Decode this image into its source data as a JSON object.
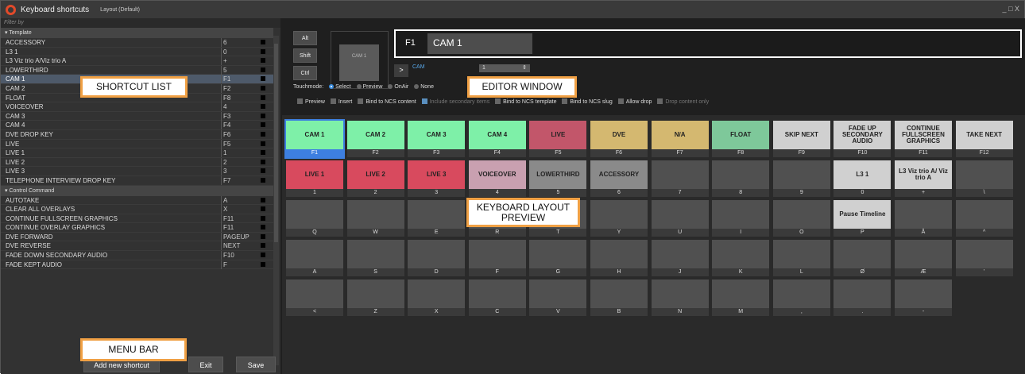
{
  "window": {
    "title": "Keyboard shortcuts",
    "layout": "Layout (Default)",
    "controls": "_ □ X"
  },
  "filter_placeholder": "Filter by",
  "template": {
    "header": "▾ Template",
    "rows": [
      {
        "name": "ACCESSORY",
        "key": "6"
      },
      {
        "name": "L3 1",
        "key": "0"
      },
      {
        "name": "L3 Viz trio A/Viz trio A",
        "key": "+"
      },
      {
        "name": "LOWERTHIRD",
        "key": "5"
      },
      {
        "name": "CAM 1",
        "key": "F1"
      },
      {
        "name": "CAM 2",
        "key": "F2"
      },
      {
        "name": "FLOAT",
        "key": "F8"
      },
      {
        "name": "VOICEOVER",
        "key": "4"
      },
      {
        "name": "CAM 3",
        "key": "F3"
      },
      {
        "name": "CAM 4",
        "key": "F4"
      },
      {
        "name": "DVE DROP KEY",
        "key": "F6"
      },
      {
        "name": "LIVE",
        "key": "F5"
      },
      {
        "name": "LIVE 1",
        "key": "1"
      },
      {
        "name": "LIVE 2",
        "key": "2"
      },
      {
        "name": "LIVE 3",
        "key": "3"
      },
      {
        "name": "TELEPHONE INTERVIEW DROP KEY",
        "key": "F7"
      }
    ]
  },
  "control": {
    "header": "▾ Control Command",
    "rows": [
      {
        "name": "AUTOTAKE",
        "key": "A"
      },
      {
        "name": "CLEAR ALL OVERLAYS",
        "key": "X"
      },
      {
        "name": "CONTINUE FULLSCREEN GRAPHICS",
        "key": "F11"
      },
      {
        "name": "CONTINUE OVERLAY GRAPHICS",
        "key": "F11"
      },
      {
        "name": "DVE FORWARD",
        "key": "PAGEUP"
      },
      {
        "name": "DVE REVERSE",
        "key": "NEXT"
      },
      {
        "name": "FADE DOWN SECONDARY AUDIO",
        "key": "F10"
      },
      {
        "name": "FADE KEPT AUDIO",
        "key": "F"
      }
    ]
  },
  "bottom_buttons": {
    "add": "Add new shortcut",
    "exit": "Exit",
    "save": "Save"
  },
  "editor": {
    "modifiers": [
      "Alt",
      "Shift",
      "Ctrl"
    ],
    "preview_text": "CAM 1",
    "key_label": "F1",
    "key_name": "CAM 1",
    "arrow": ">",
    "cam_label": "CAM",
    "cam_value": "1",
    "touchmode_label": "Touchmode:",
    "touchmodes": [
      "Select",
      "Preview",
      "OnAir",
      "None"
    ],
    "options": [
      "Preview",
      "Insert",
      "Bind to NCS content",
      "Include secondary items",
      "Bind to NCS template",
      "Bind to NCS slug",
      "Allow drop",
      "Drop content only"
    ]
  },
  "keyboard": {
    "rows": [
      [
        {
          "label": "CAM 1",
          "code": "F1",
          "color": "#7ef0a8"
        },
        {
          "label": "CAM 2",
          "code": "F2",
          "color": "#7ef0a8"
        },
        {
          "label": "CAM 3",
          "code": "F3",
          "color": "#7ef0a8"
        },
        {
          "label": "CAM 4",
          "code": "F4",
          "color": "#7ef0a8"
        },
        {
          "label": "LIVE",
          "code": "F5",
          "color": "#c2566a"
        },
        {
          "label": "DVE",
          "code": "F6",
          "color": "#d4b870"
        },
        {
          "label": "N/A",
          "code": "F7",
          "color": "#d4b870"
        },
        {
          "label": "FLOAT",
          "code": "F8",
          "color": "#7ec89a"
        },
        {
          "label": "SKIP NEXT",
          "code": "F9",
          "color": "#d0d0d0"
        },
        {
          "label": "FADE UP SECONDARY AUDIO",
          "code": "F10",
          "color": "#d0d0d0"
        },
        {
          "label": "CONTINUE FULLSCREEN GRAPHICS",
          "code": "F11",
          "color": "#d0d0d0"
        },
        {
          "label": "TAKE NEXT",
          "code": "F12",
          "color": "#d0d0d0"
        }
      ],
      [
        {
          "label": "LIVE 1",
          "code": "1",
          "color": "#d84a5e"
        },
        {
          "label": "LIVE 2",
          "code": "2",
          "color": "#d84a5e"
        },
        {
          "label": "LIVE 3",
          "code": "3",
          "color": "#d84a5e"
        },
        {
          "label": "VOICEOVER",
          "code": "4",
          "color": "#c9a0b0"
        },
        {
          "label": "LOWERTHIRD",
          "code": "5",
          "color": "#8a8a8a"
        },
        {
          "label": "ACCESSORY",
          "code": "6",
          "color": "#8a8a8a"
        },
        {
          "label": "",
          "code": "7",
          "color": ""
        },
        {
          "label": "",
          "code": "8",
          "color": ""
        },
        {
          "label": "",
          "code": "9",
          "color": ""
        },
        {
          "label": "L3 1",
          "code": "0",
          "color": "#d0d0d0"
        },
        {
          "label": "L3 Viz trio A/ Viz trio A",
          "code": "+",
          "color": "#d0d0d0"
        },
        {
          "label": "",
          "code": "\\",
          "color": ""
        }
      ],
      [
        {
          "label": "",
          "code": "Q",
          "color": ""
        },
        {
          "label": "",
          "code": "W",
          "color": ""
        },
        {
          "label": "",
          "code": "E",
          "color": ""
        },
        {
          "label": "",
          "code": "R",
          "color": ""
        },
        {
          "label": "",
          "code": "T",
          "color": ""
        },
        {
          "label": "",
          "code": "Y",
          "color": ""
        },
        {
          "label": "",
          "code": "U",
          "color": ""
        },
        {
          "label": "",
          "code": "I",
          "color": ""
        },
        {
          "label": "",
          "code": "O",
          "color": ""
        },
        {
          "label": "Pause Timeline",
          "code": "P",
          "color": "#d0d0d0"
        },
        {
          "label": "",
          "code": "Å",
          "color": ""
        },
        {
          "label": "",
          "code": "^",
          "color": ""
        }
      ],
      [
        {
          "label": "",
          "code": "A",
          "color": ""
        },
        {
          "label": "",
          "code": "S",
          "color": ""
        },
        {
          "label": "",
          "code": "D",
          "color": ""
        },
        {
          "label": "",
          "code": "F",
          "color": ""
        },
        {
          "label": "",
          "code": "G",
          "color": ""
        },
        {
          "label": "",
          "code": "H",
          "color": ""
        },
        {
          "label": "",
          "code": "J",
          "color": ""
        },
        {
          "label": "",
          "code": "K",
          "color": ""
        },
        {
          "label": "",
          "code": "L",
          "color": ""
        },
        {
          "label": "",
          "code": "Ø",
          "color": ""
        },
        {
          "label": "",
          "code": "Æ",
          "color": ""
        },
        {
          "label": "",
          "code": "'",
          "color": ""
        }
      ],
      [
        {
          "label": "",
          "code": "<",
          "color": ""
        },
        {
          "label": "",
          "code": "Z",
          "color": ""
        },
        {
          "label": "",
          "code": "X",
          "color": ""
        },
        {
          "label": "",
          "code": "C",
          "color": ""
        },
        {
          "label": "",
          "code": "V",
          "color": ""
        },
        {
          "label": "",
          "code": "B",
          "color": ""
        },
        {
          "label": "",
          "code": "N",
          "color": ""
        },
        {
          "label": "",
          "code": "M",
          "color": ""
        },
        {
          "label": "",
          "code": ",",
          "color": ""
        },
        {
          "label": "",
          "code": ".",
          "color": ""
        },
        {
          "label": "",
          "code": "-",
          "color": ""
        }
      ]
    ]
  },
  "callouts": {
    "shortcut_list": "SHORTCUT LIST",
    "editor_window": "EDITOR WINDOW",
    "keyboard_preview": "KEYBOARD LAYOUT PREVIEW",
    "menu_bar": "MENU BAR"
  },
  "colors": {
    "accent": "#3d7fe0",
    "callout_border": "#f0a044"
  }
}
